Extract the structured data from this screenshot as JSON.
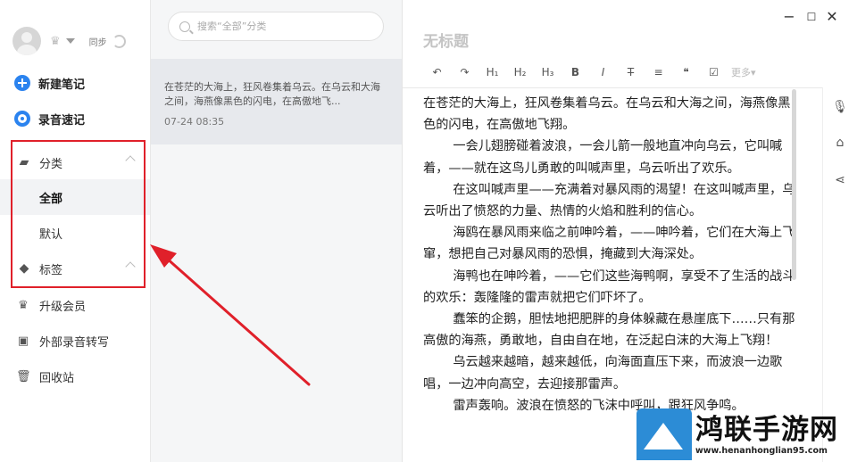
{
  "sidebar": {
    "sync_label": "同步",
    "actions": [
      {
        "label": "新建笔记"
      },
      {
        "label": "录音速记"
      }
    ],
    "category": {
      "label": "分类",
      "items": [
        {
          "label": "全部",
          "active": true
        },
        {
          "label": "默认",
          "active": false
        }
      ]
    },
    "tags": {
      "label": "标签"
    },
    "menu": [
      {
        "label": "升级会员",
        "icon": "crown-icon"
      },
      {
        "label": "外部录音转写",
        "icon": "recorder-icon"
      },
      {
        "label": "回收站",
        "icon": "trash-icon"
      }
    ]
  },
  "search": {
    "placeholder": "搜索“全部”分类"
  },
  "notes": [
    {
      "excerpt": "在苍茫的大海上，狂风卷集着乌云。在乌云和大海之间，海燕像黑色的闪电，在高傲地飞...",
      "date": "07-24 08:35"
    }
  ],
  "editor": {
    "title": "无标题",
    "toolbar": [
      "↶",
      "↷",
      "H₁",
      "H₂",
      "H₃",
      "B",
      "I",
      "T",
      "≡",
      "❝",
      "☑"
    ],
    "more_label": "更多",
    "paragraphs": [
      "在苍茫的大海上，狂风卷集着乌云。在乌云和大海之间，海燕像黑色的闪电，在高傲地飞翔。",
      "一会儿翅膀碰着波浪，一会儿箭一般地直冲向乌云，它叫喊着，——就在这鸟儿勇敢的叫喊声里，乌云听出了欢乐。",
      "在这叫喊声里——充满着对暴风雨的渴望！在这叫喊声里，乌云听出了愤怒的力量、热情的火焰和胜利的信心。",
      "海鸥在暴风雨来临之前呻吟着，——呻吟着，它们在大海上飞窜，想把自己对暴风雨的恐惧，掩藏到大海深处。",
      "海鸭也在呻吟着，——它们这些海鸭啊，享受不了生活的战斗的欢乐：轰隆隆的雷声就把它们吓坏了。",
      "蠢笨的企鹅，胆怯地把肥胖的身体躲藏在悬崖底下……只有那高傲的海燕，勇敢地，自由自在地，在泛起白沫的大海上飞翔！",
      "乌云越来越暗，越来越低，向海面直压下来，而波浪一边歌唱，一边冲向高空，去迎接那雷声。",
      "雷声轰响。波浪在愤怒的飞沫中呼叫，跟狂风争鸣。"
    ]
  },
  "watermark": {
    "name": "鸿联手游网",
    "url": "www.henanhonglian95.com"
  },
  "colors": {
    "accent": "#2b83ef",
    "highlight": "#e0202a"
  }
}
